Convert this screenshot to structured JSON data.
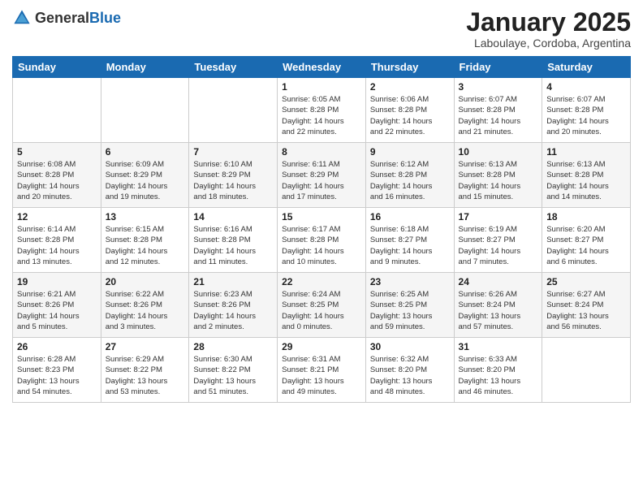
{
  "header": {
    "logo_general": "General",
    "logo_blue": "Blue",
    "month_title": "January 2025",
    "location": "Laboulaye, Cordoba, Argentina"
  },
  "days_of_week": [
    "Sunday",
    "Monday",
    "Tuesday",
    "Wednesday",
    "Thursday",
    "Friday",
    "Saturday"
  ],
  "weeks": [
    [
      {
        "day": "",
        "info": ""
      },
      {
        "day": "",
        "info": ""
      },
      {
        "day": "",
        "info": ""
      },
      {
        "day": "1",
        "info": "Sunrise: 6:05 AM\nSunset: 8:28 PM\nDaylight: 14 hours\nand 22 minutes."
      },
      {
        "day": "2",
        "info": "Sunrise: 6:06 AM\nSunset: 8:28 PM\nDaylight: 14 hours\nand 22 minutes."
      },
      {
        "day": "3",
        "info": "Sunrise: 6:07 AM\nSunset: 8:28 PM\nDaylight: 14 hours\nand 21 minutes."
      },
      {
        "day": "4",
        "info": "Sunrise: 6:07 AM\nSunset: 8:28 PM\nDaylight: 14 hours\nand 20 minutes."
      }
    ],
    [
      {
        "day": "5",
        "info": "Sunrise: 6:08 AM\nSunset: 8:28 PM\nDaylight: 14 hours\nand 20 minutes."
      },
      {
        "day": "6",
        "info": "Sunrise: 6:09 AM\nSunset: 8:29 PM\nDaylight: 14 hours\nand 19 minutes."
      },
      {
        "day": "7",
        "info": "Sunrise: 6:10 AM\nSunset: 8:29 PM\nDaylight: 14 hours\nand 18 minutes."
      },
      {
        "day": "8",
        "info": "Sunrise: 6:11 AM\nSunset: 8:29 PM\nDaylight: 14 hours\nand 17 minutes."
      },
      {
        "day": "9",
        "info": "Sunrise: 6:12 AM\nSunset: 8:28 PM\nDaylight: 14 hours\nand 16 minutes."
      },
      {
        "day": "10",
        "info": "Sunrise: 6:13 AM\nSunset: 8:28 PM\nDaylight: 14 hours\nand 15 minutes."
      },
      {
        "day": "11",
        "info": "Sunrise: 6:13 AM\nSunset: 8:28 PM\nDaylight: 14 hours\nand 14 minutes."
      }
    ],
    [
      {
        "day": "12",
        "info": "Sunrise: 6:14 AM\nSunset: 8:28 PM\nDaylight: 14 hours\nand 13 minutes."
      },
      {
        "day": "13",
        "info": "Sunrise: 6:15 AM\nSunset: 8:28 PM\nDaylight: 14 hours\nand 12 minutes."
      },
      {
        "day": "14",
        "info": "Sunrise: 6:16 AM\nSunset: 8:28 PM\nDaylight: 14 hours\nand 11 minutes."
      },
      {
        "day": "15",
        "info": "Sunrise: 6:17 AM\nSunset: 8:28 PM\nDaylight: 14 hours\nand 10 minutes."
      },
      {
        "day": "16",
        "info": "Sunrise: 6:18 AM\nSunset: 8:27 PM\nDaylight: 14 hours\nand 9 minutes."
      },
      {
        "day": "17",
        "info": "Sunrise: 6:19 AM\nSunset: 8:27 PM\nDaylight: 14 hours\nand 7 minutes."
      },
      {
        "day": "18",
        "info": "Sunrise: 6:20 AM\nSunset: 8:27 PM\nDaylight: 14 hours\nand 6 minutes."
      }
    ],
    [
      {
        "day": "19",
        "info": "Sunrise: 6:21 AM\nSunset: 8:26 PM\nDaylight: 14 hours\nand 5 minutes."
      },
      {
        "day": "20",
        "info": "Sunrise: 6:22 AM\nSunset: 8:26 PM\nDaylight: 14 hours\nand 3 minutes."
      },
      {
        "day": "21",
        "info": "Sunrise: 6:23 AM\nSunset: 8:26 PM\nDaylight: 14 hours\nand 2 minutes."
      },
      {
        "day": "22",
        "info": "Sunrise: 6:24 AM\nSunset: 8:25 PM\nDaylight: 14 hours\nand 0 minutes."
      },
      {
        "day": "23",
        "info": "Sunrise: 6:25 AM\nSunset: 8:25 PM\nDaylight: 13 hours\nand 59 minutes."
      },
      {
        "day": "24",
        "info": "Sunrise: 6:26 AM\nSunset: 8:24 PM\nDaylight: 13 hours\nand 57 minutes."
      },
      {
        "day": "25",
        "info": "Sunrise: 6:27 AM\nSunset: 8:24 PM\nDaylight: 13 hours\nand 56 minutes."
      }
    ],
    [
      {
        "day": "26",
        "info": "Sunrise: 6:28 AM\nSunset: 8:23 PM\nDaylight: 13 hours\nand 54 minutes."
      },
      {
        "day": "27",
        "info": "Sunrise: 6:29 AM\nSunset: 8:22 PM\nDaylight: 13 hours\nand 53 minutes."
      },
      {
        "day": "28",
        "info": "Sunrise: 6:30 AM\nSunset: 8:22 PM\nDaylight: 13 hours\nand 51 minutes."
      },
      {
        "day": "29",
        "info": "Sunrise: 6:31 AM\nSunset: 8:21 PM\nDaylight: 13 hours\nand 49 minutes."
      },
      {
        "day": "30",
        "info": "Sunrise: 6:32 AM\nSunset: 8:20 PM\nDaylight: 13 hours\nand 48 minutes."
      },
      {
        "day": "31",
        "info": "Sunrise: 6:33 AM\nSunset: 8:20 PM\nDaylight: 13 hours\nand 46 minutes."
      },
      {
        "day": "",
        "info": ""
      }
    ]
  ]
}
